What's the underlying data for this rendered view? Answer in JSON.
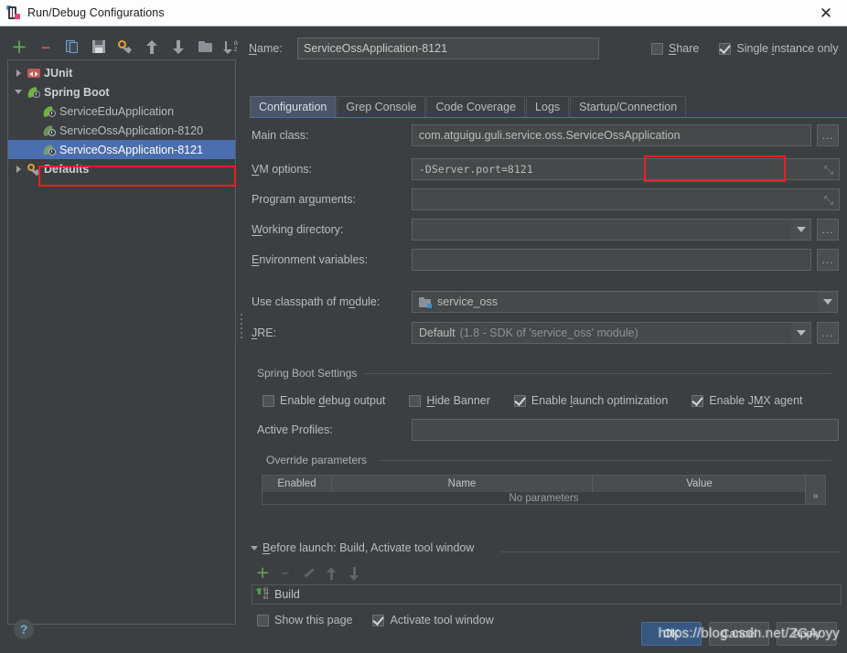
{
  "window": {
    "title": "Run/Debug Configurations",
    "close_label": "✕",
    "app_icon": "intellij-idea-icon"
  },
  "tree_toolbar": {
    "buttons": [
      {
        "name": "add-configuration-button",
        "icon": "plus-icon",
        "glyph": "+"
      },
      {
        "name": "remove-configuration-button",
        "icon": "minus-icon",
        "glyph": "–"
      },
      {
        "name": "copy-configuration-button",
        "icon": "copy-icon"
      },
      {
        "name": "save-configuration-button",
        "icon": "save-icon"
      },
      {
        "name": "edit-templates-button",
        "icon": "gear-wrench-icon"
      },
      {
        "name": "move-up-button",
        "icon": "arrow-up-icon"
      },
      {
        "name": "move-down-button",
        "icon": "arrow-down-icon"
      },
      {
        "name": "folder-button",
        "icon": "folder-icon"
      },
      {
        "name": "sort-configurations-button",
        "icon": "sort-alphabetical-icon"
      }
    ]
  },
  "tree": {
    "items": [
      {
        "label": "JUnit",
        "icon": "junit-icon",
        "indent": 0,
        "twisty": "right",
        "bold": true,
        "selected": false
      },
      {
        "label": "Spring Boot",
        "icon": "spring-boot-icon",
        "indent": 0,
        "twisty": "down",
        "bold": true,
        "selected": false
      },
      {
        "label": "ServiceEduApplication",
        "icon": "spring-boot-icon",
        "indent": 1,
        "twisty": "none",
        "bold": false,
        "selected": false
      },
      {
        "label": "ServiceOssApplication-8120",
        "icon": "spring-boot-icon",
        "indent": 1,
        "twisty": "none",
        "bold": false,
        "selected": false
      },
      {
        "label": "ServiceOssApplication-8121",
        "icon": "spring-boot-icon-dim",
        "indent": 1,
        "twisty": "none",
        "bold": false,
        "selected": true
      },
      {
        "label": "Defaults",
        "icon": "wrench-icon",
        "indent": 0,
        "twisty": "right",
        "bold": true,
        "selected": false
      }
    ],
    "highlight_annotation_color": "#ee1c24"
  },
  "header": {
    "name_label": "Name:",
    "name_value": "ServiceOssApplication-8121",
    "share_label": "Share",
    "share_checked": false,
    "single_instance_label": "Single instance only",
    "single_instance_checked": true
  },
  "tabs": [
    {
      "label": "Configuration",
      "active": true
    },
    {
      "label": "Grep Console",
      "active": false
    },
    {
      "label": "Code Coverage",
      "active": false
    },
    {
      "label": "Logs",
      "active": false
    },
    {
      "label": "Startup/Connection",
      "active": false
    }
  ],
  "form": {
    "main_class_label": "Main class:",
    "main_class_value": "com.atguigu.guli.service.oss.ServiceOssApplication",
    "vm_options_label": "VM options:",
    "vm_options_value": "-DServer.port=8121",
    "program_arguments_label": "Program arguments:",
    "program_arguments_value": "",
    "working_directory_label": "Working directory:",
    "working_directory_value": "",
    "environment_variables_label": "Environment variables:",
    "environment_variables_value": "",
    "use_classpath_label": "Use classpath of module:",
    "use_classpath_value": "service_oss",
    "jre_label": "JRE:",
    "jre_value": "Default",
    "jre_value_detail": "(1.8 - SDK of 'service_oss' module)",
    "browse_label": "...",
    "expand_label": "⤡"
  },
  "spring_boot_settings": {
    "group_title": "Spring Boot Settings",
    "checkboxes": [
      {
        "label": "Enable debug output",
        "checked": false,
        "name": "enable-debug-output-checkbox"
      },
      {
        "label": "Hide Banner",
        "checked": false,
        "name": "hide-banner-checkbox"
      },
      {
        "label": "Enable launch optimization",
        "checked": true,
        "name": "enable-launch-optimization-checkbox"
      },
      {
        "label": "Enable JMX agent",
        "checked": true,
        "name": "enable-jmx-agent-checkbox"
      }
    ],
    "active_profiles_label": "Active Profiles:",
    "active_profiles_value": ""
  },
  "override_parameters": {
    "group_title": "Override parameters",
    "columns": [
      "Enabled",
      "Name",
      "Value"
    ],
    "empty_text": "No parameters",
    "more_label": "»"
  },
  "before_launch": {
    "title": "Before launch: Build, Activate tool window",
    "toolbar": [
      {
        "name": "add-task-button",
        "icon": "plus-icon",
        "glyph": "+"
      },
      {
        "name": "remove-task-button",
        "icon": "minus-icon",
        "glyph": "–"
      },
      {
        "name": "edit-task-button",
        "icon": "pencil-icon"
      },
      {
        "name": "move-task-up-button",
        "icon": "arrow-up-icon"
      },
      {
        "name": "move-task-down-button",
        "icon": "arrow-down-icon"
      }
    ],
    "tasks": [
      {
        "label": "Build",
        "icon": "build-icon"
      }
    ],
    "show_this_page_label": "Show this page",
    "show_this_page_checked": false,
    "activate_tool_window_label": "Activate tool window",
    "activate_tool_window_checked": true
  },
  "footer": {
    "help_label": "?",
    "ok_label": "OK",
    "cancel_label": "Cancel",
    "apply_label": "Apply",
    "watermark": "https://blog.csdn.net/ZGAoyy"
  },
  "colors": {
    "background": "#3c3f41",
    "selection": "#4b6eaf",
    "accent_primary": "#365880",
    "annotation_red": "#ee1c24",
    "titlebar": "#fdfdfd"
  }
}
